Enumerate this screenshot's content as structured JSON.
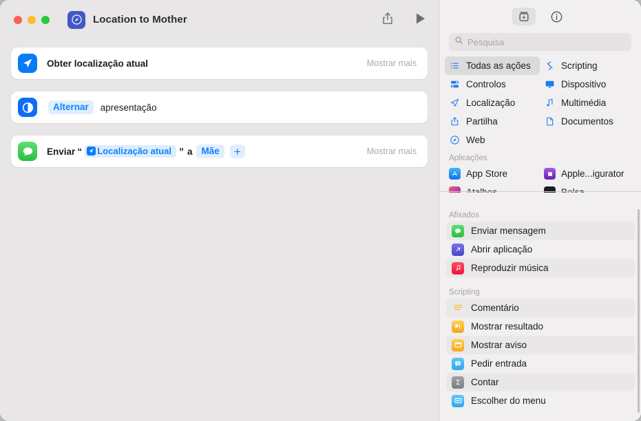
{
  "window": {
    "title": "Location to Mother",
    "app_icon": "compass-icon",
    "traffic_lights": [
      "close",
      "minimize",
      "zoom"
    ],
    "toolbar": {
      "share_label": "share-icon",
      "run_label": "play-icon"
    }
  },
  "workflow": {
    "actions": [
      {
        "icon": "navigation-arrow-icon",
        "icon_color": "#067cf8",
        "title": "Obter localização atual",
        "show_more": "Mostrar mais"
      },
      {
        "icon": "toggle-contrast-icon",
        "icon_color": "#0f6df5",
        "verb": "Alternar",
        "object": "apresentação"
      },
      {
        "icon": "messages-bubble-icon",
        "icon_color": "#34c759",
        "prefix": "Enviar",
        "open_quote": "“",
        "variable": "Localização atual",
        "close_quote": "”",
        "connector": "a",
        "recipient": "Mãe",
        "add_label": "+",
        "show_more": "Mostrar mais"
      }
    ]
  },
  "sidebar": {
    "toolbar": {
      "library_icon": "action-library-icon",
      "info_icon": "info-circle-icon"
    },
    "search": {
      "placeholder": "Pesquisa",
      "value": "",
      "icon": "search-icon"
    },
    "categories": [
      {
        "label": "Todas as ações",
        "icon": "list-bullet-icon",
        "selected": true
      },
      {
        "label": "Scripting",
        "icon": "scripting-icon",
        "selected": false
      },
      {
        "label": "Controlos",
        "icon": "controls-icon",
        "selected": false
      },
      {
        "label": "Dispositivo",
        "icon": "display-icon",
        "selected": false
      },
      {
        "label": "Localização",
        "icon": "location-arrow-icon",
        "selected": false
      },
      {
        "label": "Multimédia",
        "icon": "music-note-icon",
        "selected": false
      },
      {
        "label": "Partilha",
        "icon": "share-up-icon",
        "selected": false
      },
      {
        "label": "Documentos",
        "icon": "document-icon",
        "selected": false
      },
      {
        "label": "Web",
        "icon": "safari-compass-icon",
        "selected": false
      }
    ],
    "apps_group_label": "Aplicações",
    "apps": [
      {
        "label": "App Store",
        "icon": "app-store-icon",
        "color": "#1e90ff"
      },
      {
        "label": "Apple...igurator",
        "icon": "apple-configurator-icon",
        "color": "#8b3fd6"
      },
      {
        "label": "Atalhos",
        "icon": "shortcuts-icon",
        "color": "#e0457b"
      },
      {
        "label": "Bolsa",
        "icon": "stocks-icon",
        "color": "#1c1c1e"
      }
    ],
    "pinned_group_label": "Afixados",
    "pinned": [
      {
        "label": "Enviar mensagem",
        "icon": "messages-bubble-icon",
        "color": "#34c759",
        "highlight": true
      },
      {
        "label": "Abrir aplicação",
        "icon": "open-app-arrow-icon",
        "color": "#5b5bd6",
        "highlight": false
      },
      {
        "label": "Reproduzir música",
        "icon": "music-note-icon",
        "color": "#fa2d48",
        "highlight": true
      }
    ],
    "scripting_group_label": "Scripting",
    "scripting": [
      {
        "label": "Comentário",
        "icon": "comment-lines-icon",
        "color": "#f1eff0",
        "highlight": true
      },
      {
        "label": "Mostrar resultado",
        "icon": "show-result-icon",
        "color": "#ffc107",
        "highlight": false
      },
      {
        "label": "Mostrar aviso",
        "icon": "alert-window-icon",
        "color": "#ffc107",
        "highlight": true
      },
      {
        "label": "Pedir entrada",
        "icon": "ask-input-icon",
        "color": "#4cb8f5",
        "highlight": false
      },
      {
        "label": "Contar",
        "icon": "sigma-count-icon",
        "color": "#8e8e93",
        "highlight": true
      },
      {
        "label": "Escolher do menu",
        "icon": "choose-menu-icon",
        "color": "#4cb8f5",
        "highlight": false
      }
    ]
  }
}
